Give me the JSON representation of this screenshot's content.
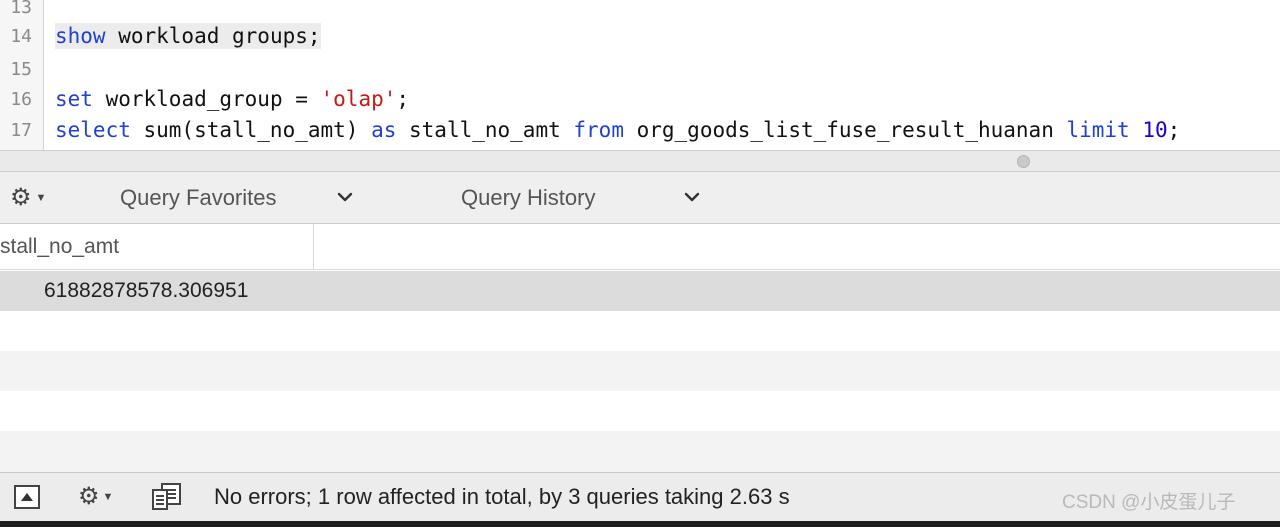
{
  "editor": {
    "lines": [
      {
        "num": "13"
      },
      {
        "num": "14",
        "show": "show",
        "rest": " workload groups",
        "end": ";"
      },
      {
        "num": "15"
      },
      {
        "num": "16",
        "set": "set",
        "mid": " workload_group = ",
        "str": "'olap'",
        "end": ";"
      },
      {
        "num": "17",
        "select": "select",
        "sum": " sum(stall_no_amt) ",
        "as": "as",
        "alias": " stall_no_amt ",
        "from": "from",
        "table": " org_goods_list_fuse_result_huanan ",
        "limit": "limit",
        "n": " 10",
        "end": ";"
      }
    ]
  },
  "toolbar": {
    "gear_icon": "gear-icon",
    "favorites_label": "Query Favorites",
    "history_label": "Query History"
  },
  "results": {
    "columns": [
      "stall_no_amt"
    ],
    "rows": [
      [
        "61882878578.306951"
      ]
    ]
  },
  "status": {
    "message": "No errors; 1 row affected in total, by 3 queries taking 2.63 s"
  },
  "watermark": "CSDN @小皮蛋儿子"
}
